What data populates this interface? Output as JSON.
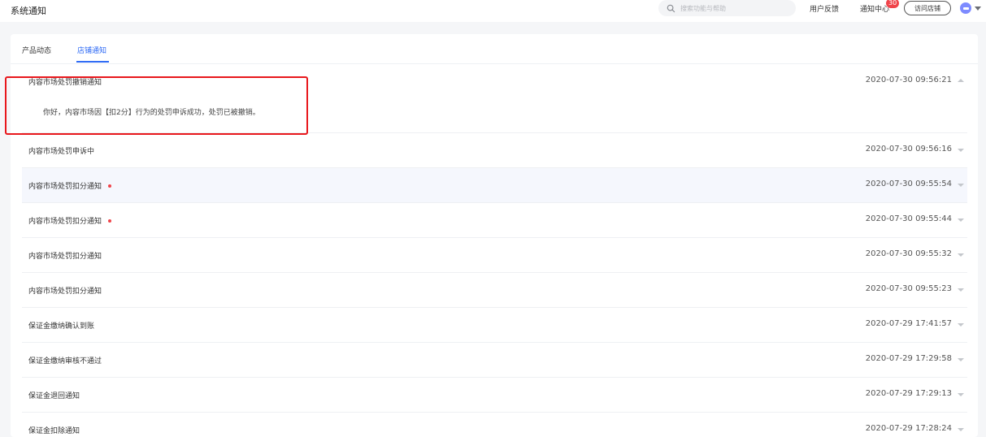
{
  "page_title": "系统通知",
  "search": {
    "placeholder": "搜索功能与帮助"
  },
  "header": {
    "feedback": "用户反馈",
    "notice_center": "通知中心",
    "notice_count": "30",
    "visit_store": "访问店铺"
  },
  "tabs": [
    {
      "label": "产品动态",
      "active": false
    },
    {
      "label": "店铺通知",
      "active": true
    }
  ],
  "notifications": [
    {
      "title": "内容市场处罚撤销通知",
      "time": "2020-07-30 09:56:21",
      "expanded": true,
      "body": "你好，内容市场因【扣2分】行为的处罚申诉成功，处罚已被撤销。"
    },
    {
      "title": "内容市场处罚申诉中",
      "time": "2020-07-30 09:56:16"
    },
    {
      "title": "内容市场处罚扣分通知",
      "time": "2020-07-30 09:55:54",
      "unread": true
    },
    {
      "title": "内容市场处罚扣分通知",
      "time": "2020-07-30 09:55:44",
      "unread": true
    },
    {
      "title": "内容市场处罚扣分通知",
      "time": "2020-07-30 09:55:32"
    },
    {
      "title": "内容市场处罚扣分通知",
      "time": "2020-07-30 09:55:23"
    },
    {
      "title": "保证金缴纳确认到账",
      "time": "2020-07-29 17:41:57"
    },
    {
      "title": "保证金缴纳审核不通过",
      "time": "2020-07-29 17:29:58"
    },
    {
      "title": "保证金退回通知",
      "time": "2020-07-29 17:29:13"
    },
    {
      "title": "保证金扣除通知",
      "time": "2020-07-29 17:28:24"
    }
  ],
  "colors": {
    "accent": "#2f6bf5",
    "unread_dot": "#f0444a",
    "highlight_box": "#e8171c"
  },
  "icons": {
    "search": "search-icon",
    "bell": "bell-icon",
    "avatar": "avatar-icon",
    "expand": "chevron-icon"
  }
}
